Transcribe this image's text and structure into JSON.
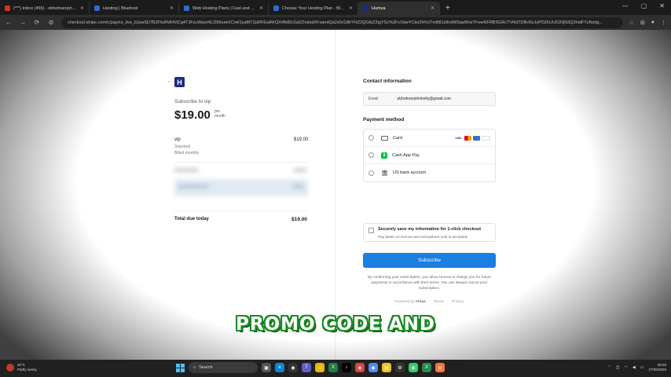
{
  "browser": {
    "tabs": [
      {
        "label": "(***) Inbox (455) - ebhohoerjohnkelly",
        "fav_color": "#d93025",
        "active": false
      },
      {
        "label": "Hosting | Bluehost",
        "fav_color": "#2f6bd8",
        "active": false
      },
      {
        "label": "Web Hosting Plans | Fast and S...",
        "fav_color": "#2f6bd8",
        "active": false
      },
      {
        "label": "Choose Your Hosting Plan - Bl...",
        "fav_color": "#2f6bd8",
        "active": false
      },
      {
        "label": "Humva",
        "fav_color": "#1c2a8a",
        "active": true
      }
    ],
    "new_tab": "+",
    "url": "checkout.stripe.com/c/pay/cs_live_b1paSD7BZFtsKMHVtCg4TJFzuWazo6LD96uekXCwiI1yaMTZpRFEwlRrQX#fidl2cGd2ZndsdXFsamtQa2x0cGBrYHZ2QGtkZ2tgYSc%2FcXdwYCknZHVsTmB8Jz8ndW5aaWxsYFowNFRBSGRcTVRdTDBcRzJyPDZkUU51RjN3Q2hidFYzNzdg..."
  },
  "page": {
    "back_arrow": "←",
    "logo_letter": "H",
    "subscribe_label": "Subscribe to vip",
    "price": "$19.00",
    "per_line1": "per",
    "per_line2": "month",
    "item": {
      "name": "vip",
      "tier": "Standard",
      "billing": "Billed monthly",
      "price": "$19.00"
    },
    "total_label": "Total due today",
    "total_price": "$19.00",
    "contact_title": "Contact information",
    "email_label": "Email",
    "email_value": "ebhohoerjohnkelly@gmail.com",
    "payment_title": "Payment method",
    "payment_methods": [
      {
        "label": "Card",
        "icon": "card-icon"
      },
      {
        "label": "Cash App Pay",
        "icon": "cashapp-icon"
      },
      {
        "label": "US bank account",
        "icon": "bank-icon"
      }
    ],
    "card_brands": [
      "VISA",
      "MC",
      "AMEX",
      "DISCOVER"
    ],
    "save_title": "Securely save my information for 1-click checkout",
    "save_sub": "Pay faster on Humva and everywhere Link is accepted.",
    "subscribe_button": "Subscribe",
    "legal": "By confirming your subscription, you allow Humva to charge you for future payments in accordance with their terms. You can always cancel your subscription.",
    "powered_by": "Powered by",
    "stripe": "stripe",
    "terms": "Terms",
    "privacy": "Privacy"
  },
  "caption": "PROMO CODE AND",
  "taskbar": {
    "weather_temp": "34°C",
    "weather_desc": "Partly sunny",
    "search_placeholder": "Search",
    "time": "09:25",
    "date": "27/05/2025"
  },
  "colors": {
    "accent": "#1a7fe0",
    "brand": "#1c2a8a",
    "caption_outline": "#1d8a25"
  }
}
